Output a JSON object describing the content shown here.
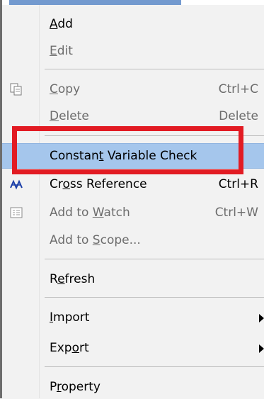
{
  "menu": {
    "items": [
      {
        "label": "Add",
        "accel": "A",
        "rest": "dd",
        "shortcut": ""
      },
      {
        "label": "Edit",
        "accel": "E",
        "rest": "dit",
        "shortcut": ""
      },
      {
        "label": "Copy",
        "accel": "C",
        "rest": "opy",
        "shortcut": "Ctrl+C",
        "icon": "copy-icon"
      },
      {
        "label": "Delete",
        "accel": "D",
        "rest": "elete",
        "shortcut": "Delete"
      },
      {
        "label": "Constant Variable Check",
        "pre": "Constan",
        "accel": "t",
        "rest": " Variable Check"
      },
      {
        "label": "Cross Reference",
        "pre": "Cr",
        "accel": "o",
        "rest": "ss Reference",
        "shortcut": "Ctrl+R",
        "icon": "cross-reference-icon"
      },
      {
        "label": "Add to Watch",
        "pre": "Add to ",
        "accel": "W",
        "rest": "atch",
        "shortcut": "Ctrl+W",
        "icon": "watch-icon"
      },
      {
        "label": "Add to Scope...",
        "pre": "Add to ",
        "accel": "S",
        "rest": "cope...",
        "shortcut": ""
      },
      {
        "label": "Refresh",
        "pre": "R",
        "accel": "e",
        "rest": "fresh"
      },
      {
        "label": "Import",
        "accel": "I",
        "rest": "mport"
      },
      {
        "label": "Export",
        "pre": "Exp",
        "accel": "o",
        "rest": "rt"
      },
      {
        "label": "Property",
        "pre": "P",
        "accel": "r",
        "rest": "operty"
      }
    ]
  },
  "colors": {
    "highlight_box": "#e21b23",
    "active_item": "#a5c6ec",
    "disabled_text": "#6d6d6d"
  }
}
